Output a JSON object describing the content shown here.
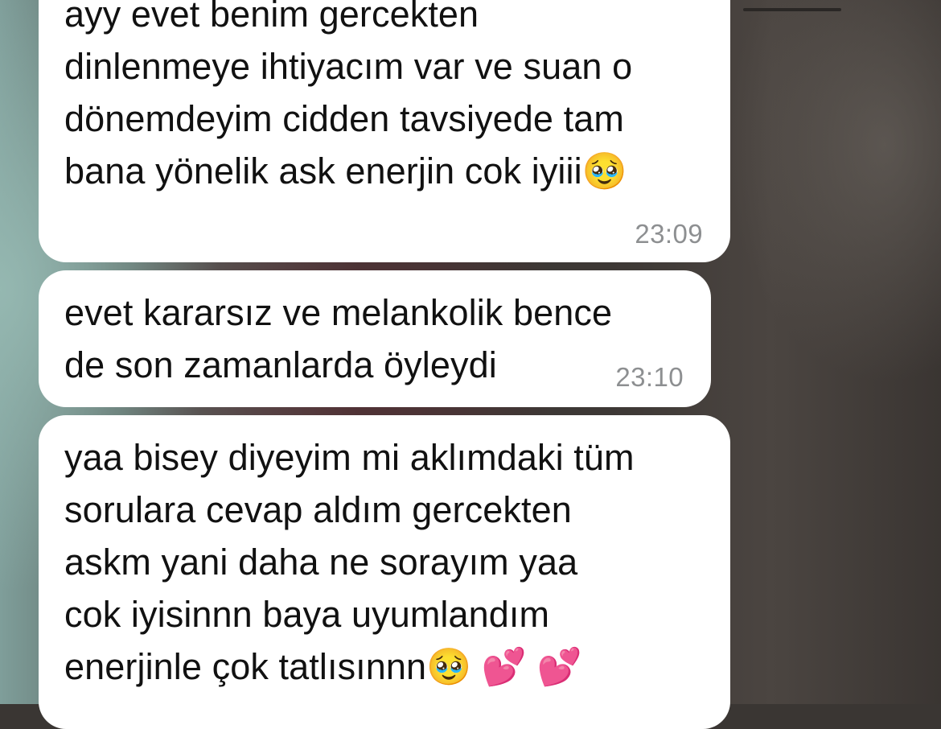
{
  "chat": {
    "messages": [
      {
        "text": "ayy evet benim gercekten\ndinlenmeye ihtiyacım var ve suan o\ndönemdeyim cidden tavsiyede tam\nbana yönelik ask enerjin cok iyiii🥹",
        "time": "23:09"
      },
      {
        "text": "evet kararsız ve melankolik bence\nde son zamanlarda öyleydi",
        "time": "23:10"
      },
      {
        "text": "yaa bisey diyeyim mi aklımdaki tüm\nsorulara cevap aldım gercekten\naskm yani daha ne sorayım yaa\ncok iyisinnn baya uyumlandım\nenerjinle çok tatlısınnn🥹 💕 💕"
      }
    ]
  },
  "theme": {
    "bubble_bg": "#ffffff",
    "text_color": "#111111",
    "time_color": "#8d8f91",
    "background_dark": "#3a3633"
  }
}
